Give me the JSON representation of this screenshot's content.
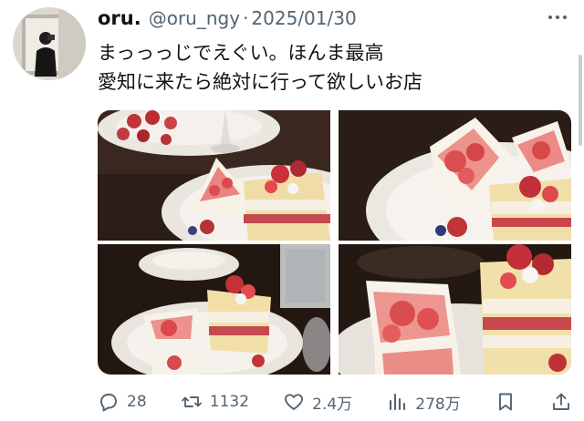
{
  "post": {
    "author_name": "oru.",
    "handle": "@oru_ngy",
    "separator": "·",
    "date": "2025/01/30",
    "text_line1": "まっっっじでえぐい。ほんま最高",
    "text_line2": "愛知に来たら絶対に行って欲しいお店"
  },
  "media": {
    "photo_count": 4
  },
  "actions": {
    "reply_count": "28",
    "repost_count": "1132",
    "like_count": "2.4万",
    "view_count": "278万"
  },
  "icons": [
    "more-icon",
    "reply-icon",
    "repost-icon",
    "like-icon",
    "views-icon",
    "bookmark-icon",
    "share-icon"
  ]
}
